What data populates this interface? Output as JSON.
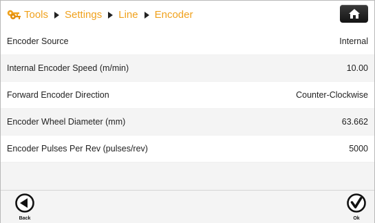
{
  "header": {
    "breadcrumb": [
      "Tools",
      "Settings",
      "Line",
      "Encoder"
    ],
    "home_icon": "home-icon",
    "keys_icon": "keys-icon",
    "accent_color": "#f0a11c"
  },
  "settings": [
    {
      "label": "Encoder Source",
      "value": "Internal"
    },
    {
      "label": "Internal Encoder Speed (m/min)",
      "value": "10.00"
    },
    {
      "label": "Forward Encoder Direction",
      "value": "Counter-Clockwise"
    },
    {
      "label": "Encoder Wheel Diameter (mm)",
      "value": "63.662"
    },
    {
      "label": "Encoder Pulses Per Rev (pulses/rev)",
      "value": "5000"
    }
  ],
  "footer": {
    "back_label": "Back",
    "ok_label": "Ok"
  }
}
